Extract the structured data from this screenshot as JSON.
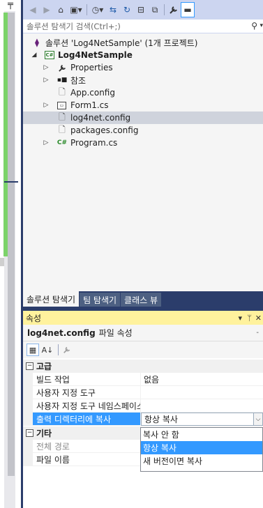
{
  "toolbar": {
    "buttons": [
      {
        "name": "back-icon",
        "glyph": "◀"
      },
      {
        "name": "forward-icon",
        "glyph": "▶"
      },
      {
        "name": "home-icon",
        "glyph": "⌂"
      },
      {
        "name": "collection-icon",
        "glyph": "▣"
      },
      {
        "name": "history-icon",
        "glyph": "◷"
      },
      {
        "name": "sync-icon",
        "glyph": "⇆"
      },
      {
        "name": "refresh-icon",
        "glyph": "↻"
      },
      {
        "name": "collapse-all-icon",
        "glyph": "⊟"
      },
      {
        "name": "show-all-files-icon",
        "glyph": "⧉"
      },
      {
        "name": "properties-wrench-icon",
        "glyph": "🔧"
      },
      {
        "name": "preview-icon",
        "glyph": "▬"
      }
    ]
  },
  "search": {
    "placeholder": "솔루션 탐색기 검색(Ctrl+;)"
  },
  "tree": {
    "solution": "솔루션 'Log4NetSample' (1개 프로젝트)",
    "project": "Log4NetSample",
    "items": [
      {
        "label": "Properties",
        "icon": "wrench-icon",
        "expandable": true
      },
      {
        "label": "참조",
        "icon": "references-icon",
        "expandable": true
      },
      {
        "label": "App.config",
        "icon": "config-file-icon",
        "expandable": false
      },
      {
        "label": "Form1.cs",
        "icon": "form-icon",
        "expandable": true
      },
      {
        "label": "log4net.config",
        "icon": "config-file-icon",
        "expandable": false,
        "selected": true
      },
      {
        "label": "packages.config",
        "icon": "config-file-icon",
        "expandable": false
      },
      {
        "label": "Program.cs",
        "icon": "csharp-file-icon",
        "expandable": true
      }
    ]
  },
  "tabs": [
    "솔루션 탐색기",
    "팀 탐색기",
    "클래스 뷰"
  ],
  "properties": {
    "title": "속성",
    "object_name": "log4net.config",
    "object_type": "파일 속성",
    "categories": [
      {
        "name": "고급",
        "rows": [
          {
            "name": "빌드 작업",
            "value": "없음"
          },
          {
            "name": "사용자 지정 도구",
            "value": ""
          },
          {
            "name": "사용자 지정 도구 네임스페이스",
            "value": ""
          },
          {
            "name": "출력 디렉터리에 복사",
            "value": "항상 복사"
          }
        ]
      },
      {
        "name": "기타",
        "rows": [
          {
            "name": "전체 경로",
            "value": ""
          },
          {
            "name": "파일 이름",
            "value": ""
          }
        ]
      }
    ],
    "dropdown_options": [
      "복사 안 함",
      "항상 복사",
      "새 버전이면 복사"
    ],
    "dropdown_selected": "항상 복사"
  },
  "colors": {
    "accent": "#3399ff",
    "title_bar": "#fff29d",
    "frame": "#2b3d6b",
    "toolbar": "#ccd5f0"
  }
}
